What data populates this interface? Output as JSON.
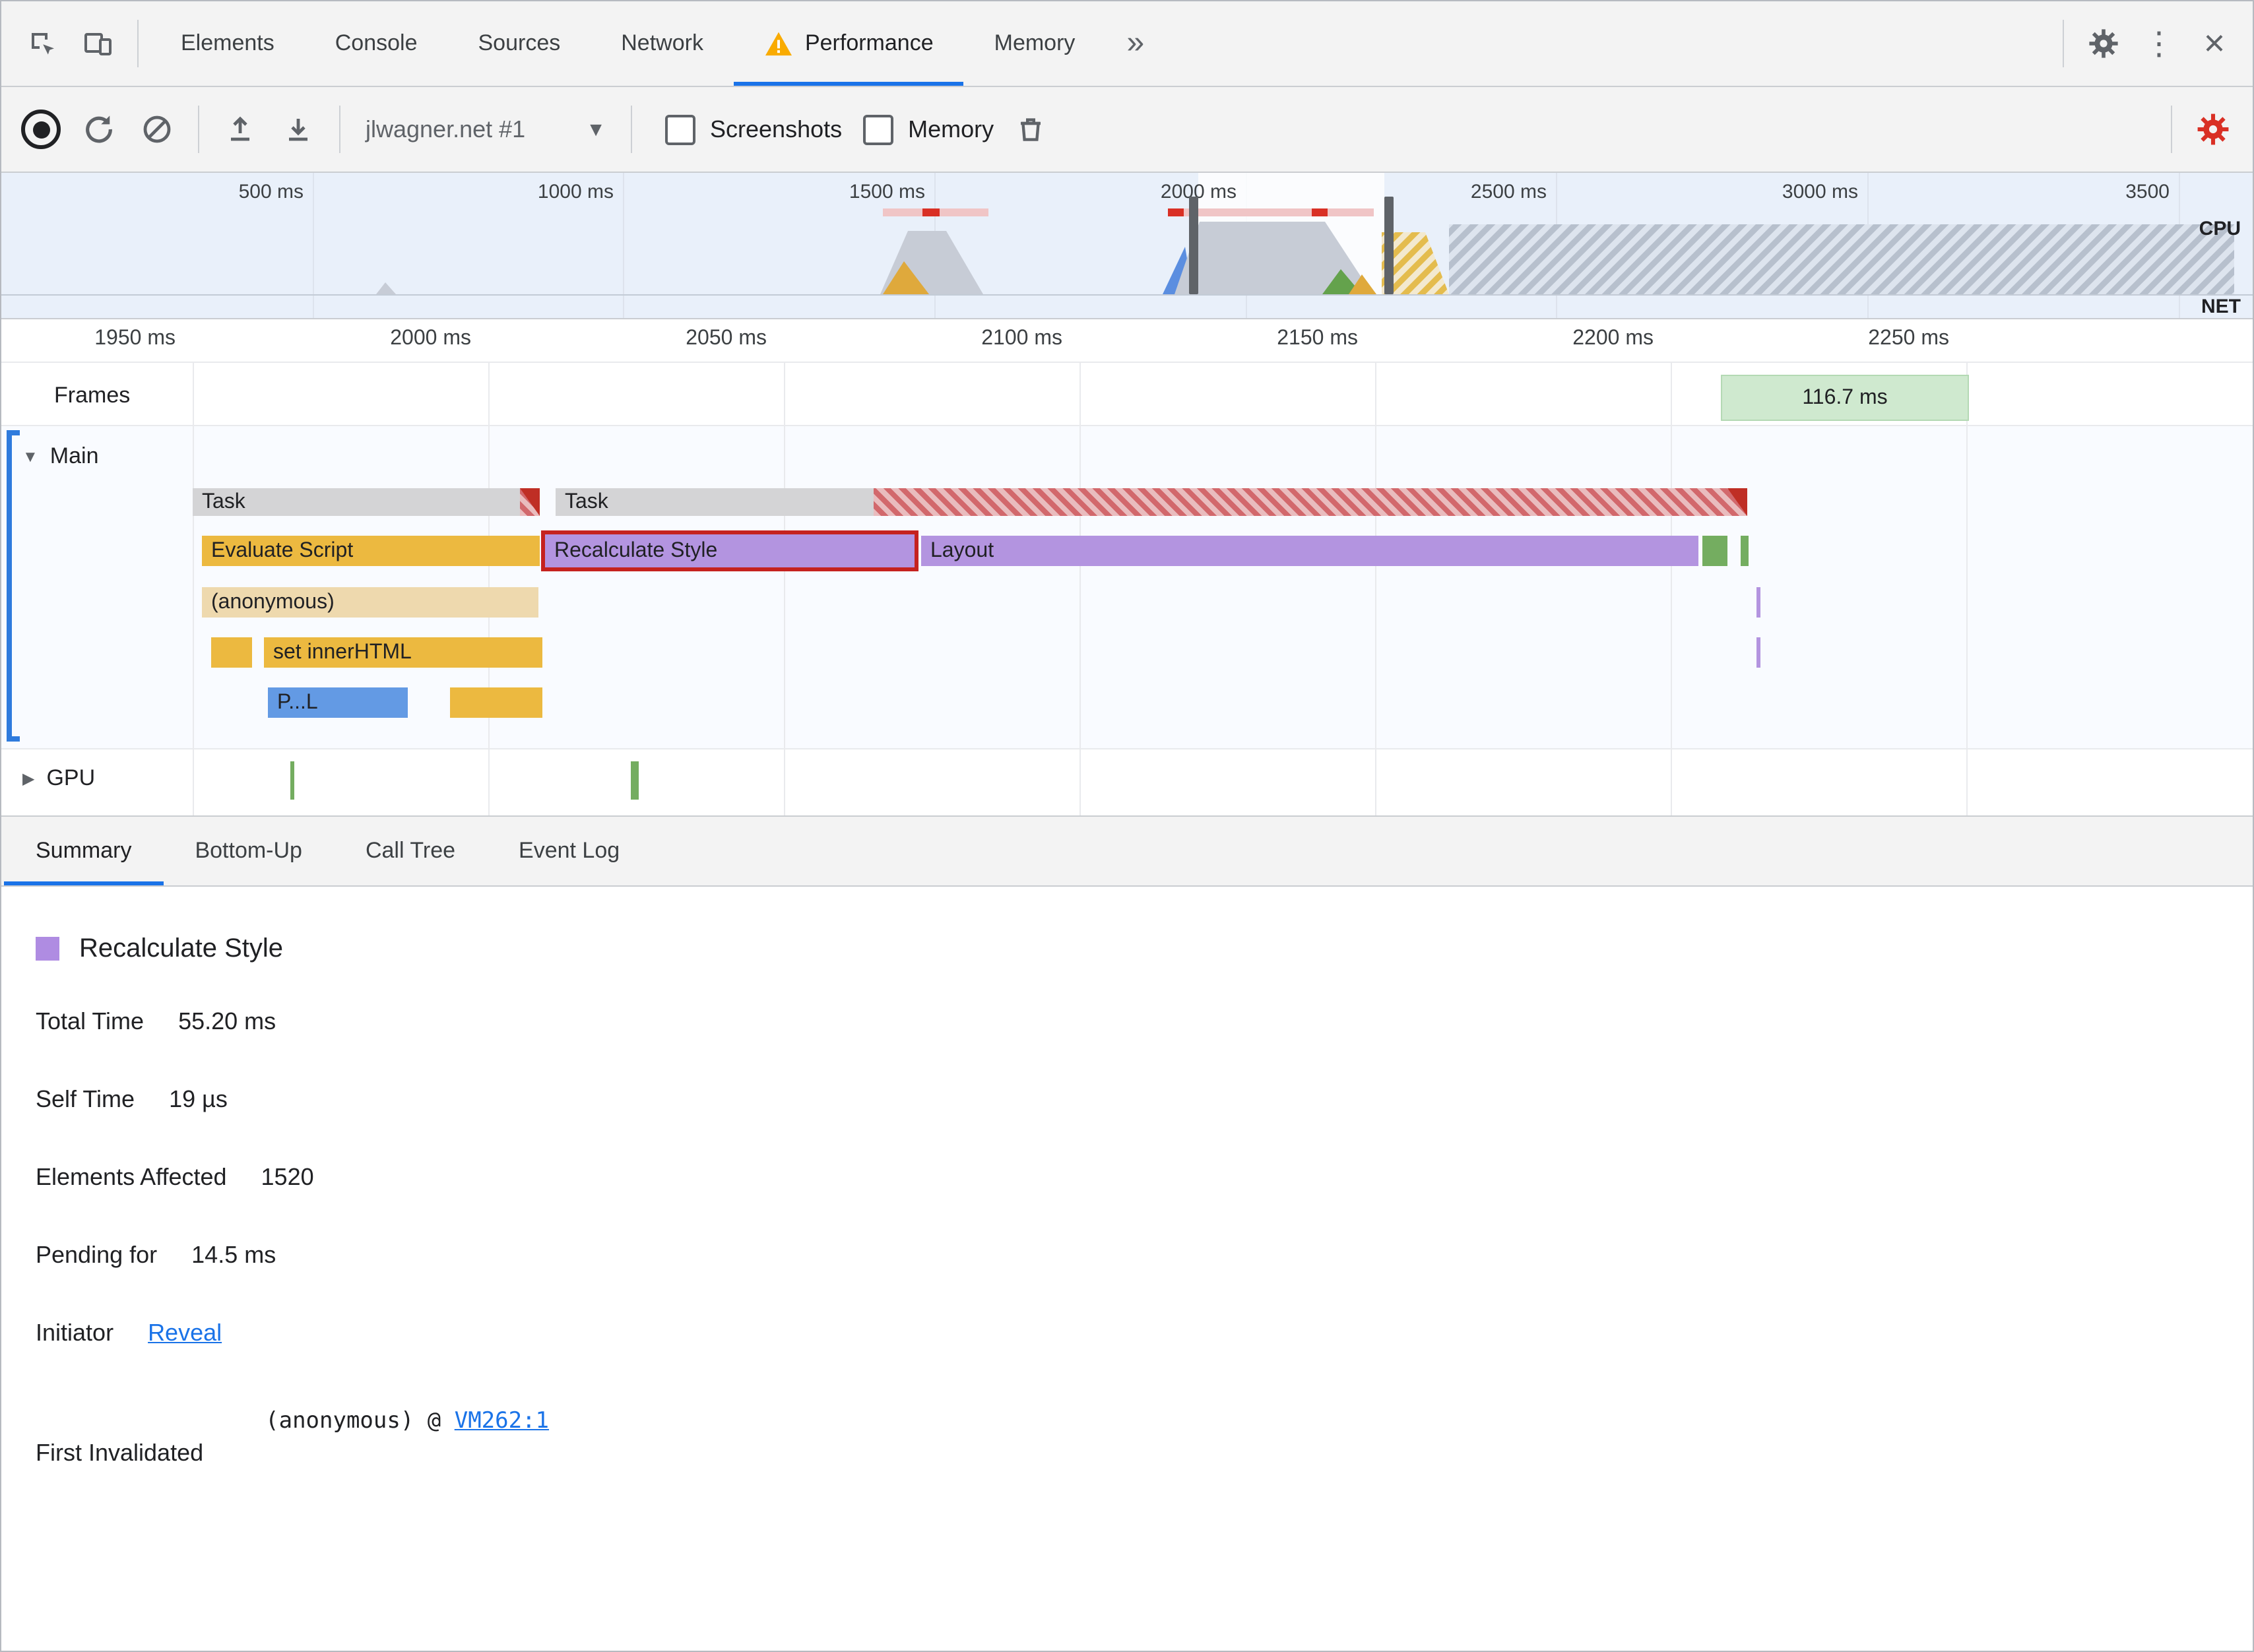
{
  "accent_colors": {
    "blue": "#1a73e8",
    "red_highlight": "#c5221f",
    "scripting_yellow": "#ecb940",
    "rendering_purple": "#b394e0",
    "painting_green": "#74ad60",
    "task_gray": "#d4d4d6",
    "frame_green": "#cfe9cf"
  },
  "icons": {
    "more_tabs": "»",
    "kebab": "⋮",
    "close": "×",
    "dropdown_arrow": "▼",
    "collapse_arrow": "▼",
    "expand_arrow": "▶"
  },
  "devtools_tabs": {
    "items": [
      {
        "label": "Elements"
      },
      {
        "label": "Console"
      },
      {
        "label": "Sources"
      },
      {
        "label": "Network"
      },
      {
        "label": "Performance"
      },
      {
        "label": "Memory"
      }
    ]
  },
  "perf_toolbar": {
    "profile_select_value": "jlwagner.net #1",
    "screenshots_label": "Screenshots",
    "memory_label": "Memory"
  },
  "overview": {
    "ticks": [
      "500 ms",
      "1000 ms",
      "1500 ms",
      "2000 ms",
      "2500 ms",
      "3000 ms",
      "3500"
    ],
    "cpu_label": "CPU",
    "net_label": "NET"
  },
  "timeline": {
    "ticks": [
      "1950 ms",
      "2000 ms",
      "2050 ms",
      "2100 ms",
      "2150 ms",
      "2200 ms",
      "2250 ms"
    ],
    "frames_label": "Frames",
    "frame_duration": "116.7 ms",
    "main_track_label": "Main",
    "gpu_track_label": "GPU",
    "bars": {
      "task1": "Task",
      "task2": "Task",
      "evaluate_script": "Evaluate Script",
      "recalculate_style": "Recalculate Style",
      "layout": "Layout",
      "anonymous": "(anonymous)",
      "set_inner_html": "set innerHTML",
      "parse_truncated": "P...L"
    }
  },
  "bottom_tabs": {
    "items": [
      {
        "label": "Summary"
      },
      {
        "label": "Bottom-Up"
      },
      {
        "label": "Call Tree"
      },
      {
        "label": "Event Log"
      }
    ]
  },
  "summary": {
    "title": "Recalculate Style",
    "rows": [
      {
        "label": "Total Time",
        "value": "55.20 ms"
      },
      {
        "label": "Self Time",
        "value": "19 µs"
      },
      {
        "label": "Elements Affected",
        "value": "1520"
      },
      {
        "label": "Pending for",
        "value": "14.5 ms"
      }
    ],
    "initiator_label": "Initiator",
    "initiator_link": "Reveal",
    "first_invalidated_label": "First Invalidated",
    "first_invalidated_prefix": "(anonymous) @ ",
    "first_invalidated_link": "VM262:1"
  }
}
